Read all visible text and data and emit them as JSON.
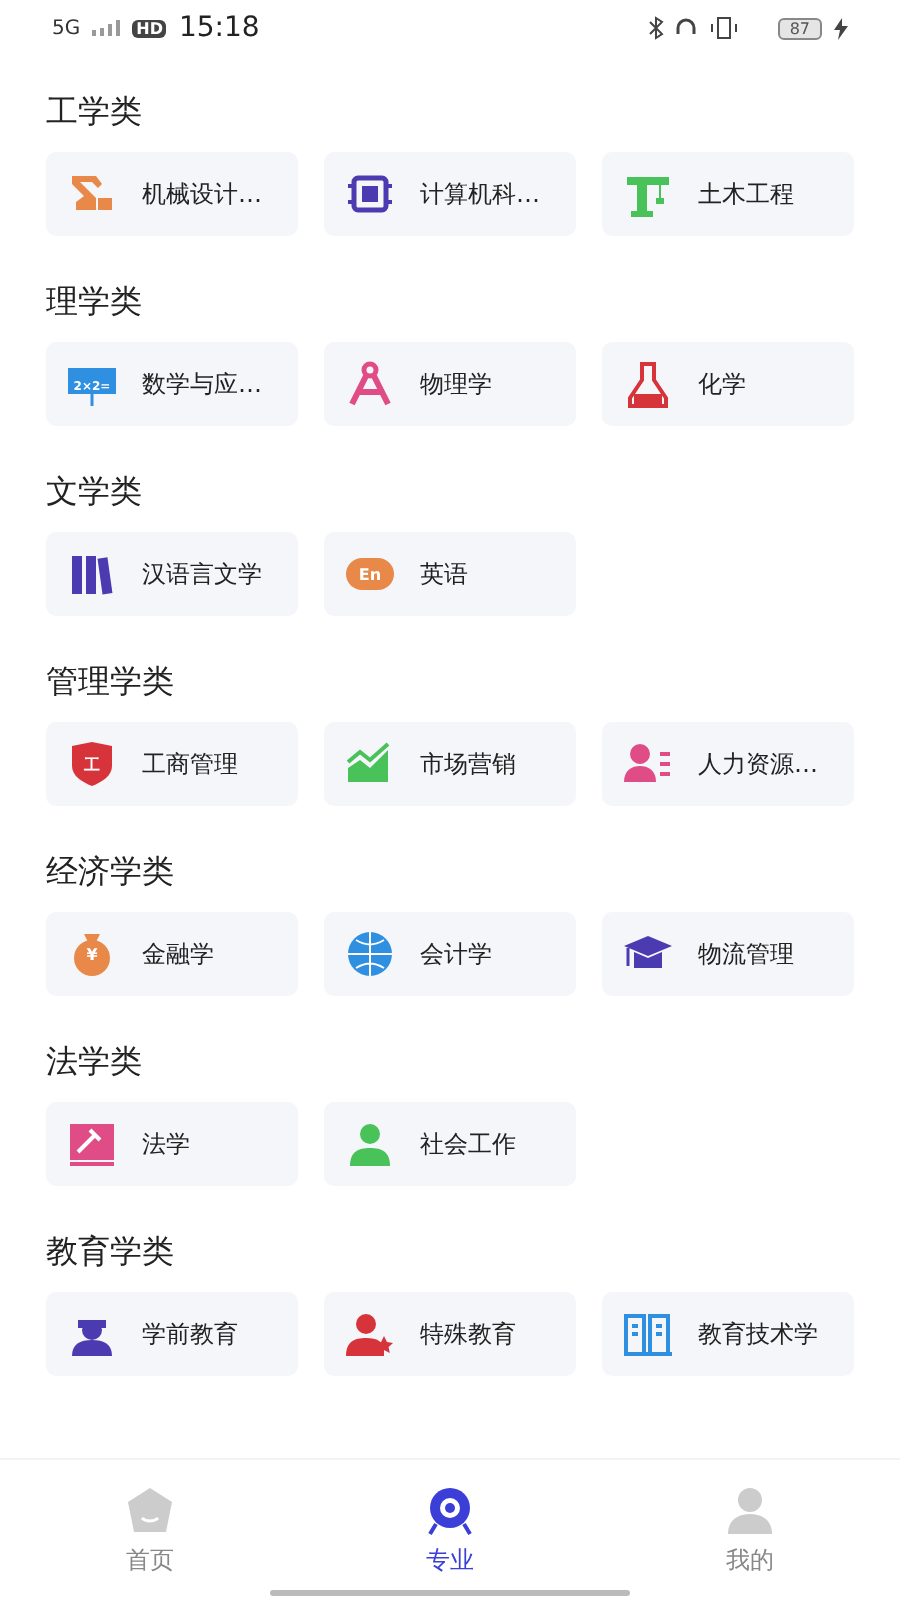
{
  "status_bar": {
    "network": "5G",
    "hd": "HD",
    "time": "15:18",
    "battery": "87"
  },
  "sections": [
    {
      "title": "工学类",
      "items": [
        {
          "label": "机械设计…",
          "kind": "arm",
          "color": "#e8894a"
        },
        {
          "label": "计算机科…",
          "kind": "chip",
          "color": "#4b3bb0"
        },
        {
          "label": "土木工程",
          "kind": "crane",
          "color": "#49c25a"
        }
      ]
    },
    {
      "title": "理学类",
      "items": [
        {
          "label": "数学与应…",
          "kind": "board",
          "color": "#2f8fe0",
          "glyph": "2×2="
        },
        {
          "label": "物理学",
          "kind": "compass",
          "color": "#e04d86"
        },
        {
          "label": "化学",
          "kind": "flask",
          "color": "#d6343a"
        }
      ]
    },
    {
      "title": "文学类",
      "items": [
        {
          "label": "汉语言文学",
          "kind": "books",
          "color": "#4b3bb0"
        },
        {
          "label": "英语",
          "kind": "pill",
          "color": "#e8894a",
          "glyph": "En"
        }
      ]
    },
    {
      "title": "管理学类",
      "items": [
        {
          "label": "工商管理",
          "kind": "shield",
          "color": "#d6343a",
          "glyph": "工"
        },
        {
          "label": "市场营销",
          "kind": "chart",
          "color": "#49c25a"
        },
        {
          "label": "人力资源…",
          "kind": "people",
          "color": "#e04d86"
        }
      ]
    },
    {
      "title": "经济学类",
      "items": [
        {
          "label": "金融学",
          "kind": "bag",
          "color": "#e8894a",
          "glyph": "¥"
        },
        {
          "label": "会计学",
          "kind": "globe",
          "color": "#2f8fe0"
        },
        {
          "label": "物流管理",
          "kind": "cap",
          "color": "#4b3bb0"
        }
      ]
    },
    {
      "title": "法学类",
      "items": [
        {
          "label": "法学",
          "kind": "gavel",
          "color": "#e04d86"
        },
        {
          "label": "社会工作",
          "kind": "worker",
          "color": "#49c25a"
        }
      ]
    },
    {
      "title": "教育学类",
      "items": [
        {
          "label": "学前教育",
          "kind": "child",
          "color": "#4b3bb0"
        },
        {
          "label": "特殊教育",
          "kind": "starperson",
          "color": "#d6343a"
        },
        {
          "label": "教育技术学",
          "kind": "building",
          "color": "#2f8fe0"
        }
      ]
    }
  ],
  "tabs": [
    {
      "label": "首页",
      "kind": "home",
      "selected": false
    },
    {
      "label": "专业",
      "kind": "eye",
      "selected": true
    },
    {
      "label": "我的",
      "kind": "person",
      "selected": false
    }
  ]
}
